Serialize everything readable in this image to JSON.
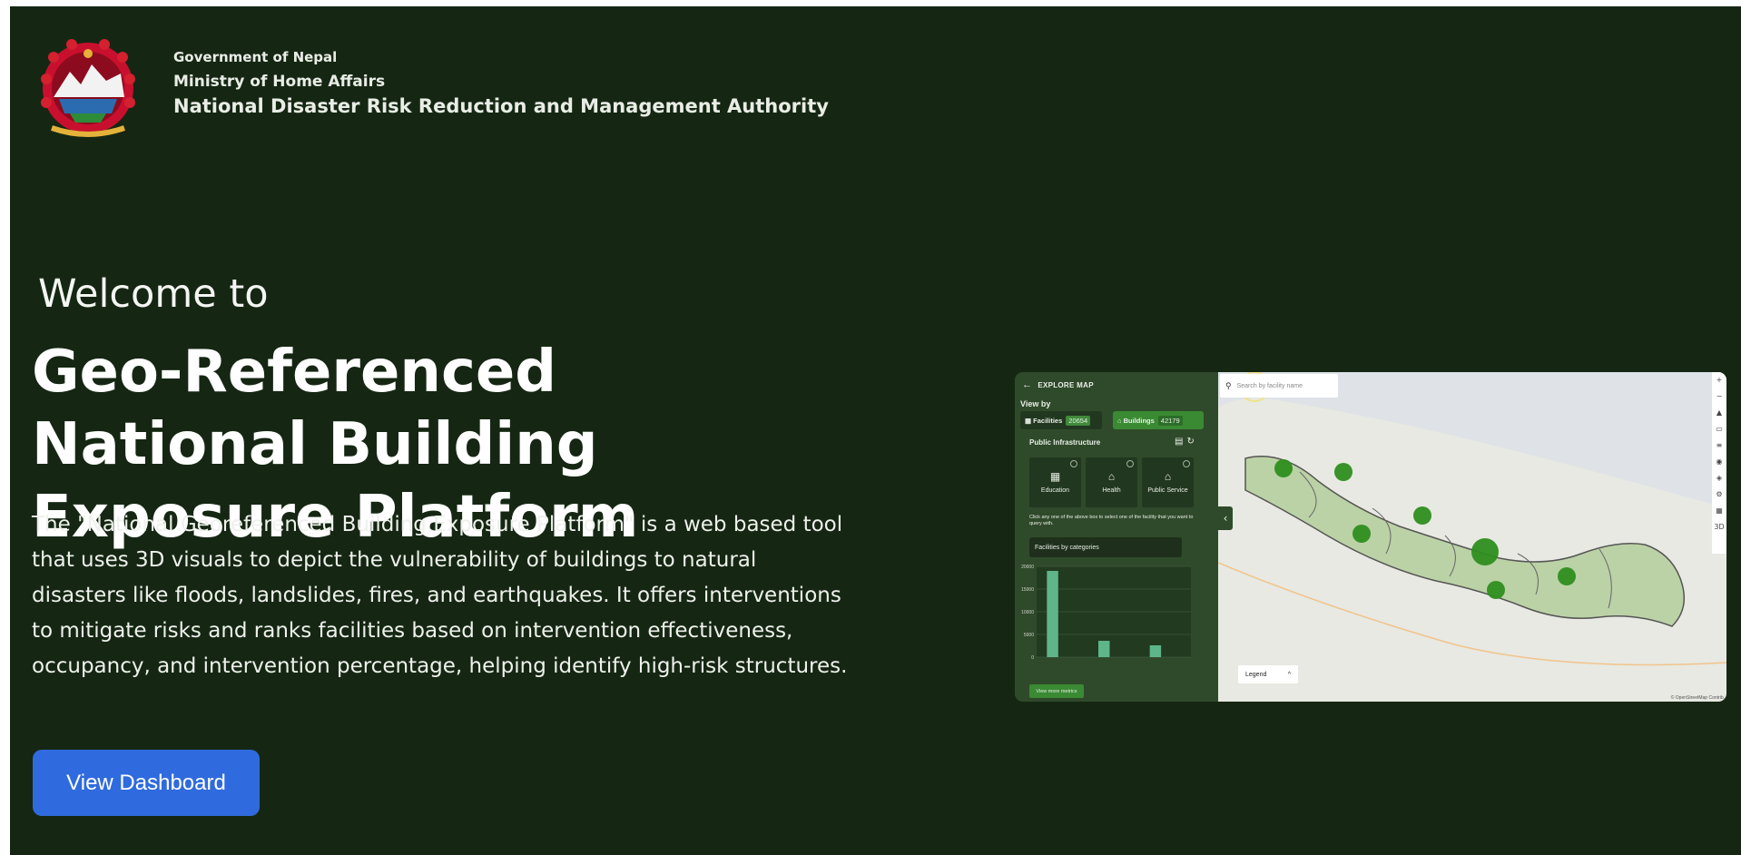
{
  "header": {
    "line1": "Government of Nepal",
    "line2": "Ministry of Home Affairs",
    "line3": "National Disaster Risk Reduction and Management Authority"
  },
  "hero": {
    "welcome": "Welcome to",
    "title": "Geo-Referenced National Building Exposure Platform",
    "description": "The \"National Georeferenced Building Exposure Platform\" is a web based tool that uses 3D visuals to depict the vulnerability of buildings to natural disasters like floods, landslides, fires, and earthquakes. It offers interventions to mitigate risks and ranks facilities based on intervention effectiveness, occupancy, and intervention percentage, helping identify high-risk structures.",
    "cta_label": "View Dashboard"
  },
  "colors": {
    "background": "#152713",
    "cta": "#2f6bde",
    "panel": "#2f4a2a",
    "accent_green": "#3a8a33",
    "bar": "#5fb58a",
    "map_marker": "#2f8f1f"
  },
  "preview": {
    "panel_title": "EXPLORE MAP",
    "view_by_label": "View by",
    "facilities_label": "Facilities",
    "facilities_count": "20654",
    "buildings_label": "Buildings",
    "buildings_count": "42179",
    "public_infra_label": "Public Infrastructure",
    "categories": [
      {
        "label": "Education",
        "icon": "building-icon"
      },
      {
        "label": "Health",
        "icon": "house-icon"
      },
      {
        "label": "Public Service",
        "icon": "bank-icon"
      }
    ],
    "hint": "Click any one of the above box to select one of the facility that you want to query with.",
    "facilities_by_categories": "Facilities by categories",
    "chart_ticks": [
      "20000",
      "15000",
      "10000",
      "5000",
      "0"
    ],
    "bar_values": [
      19000,
      3600,
      2600
    ],
    "view_more_label": "View more metrics",
    "search_placeholder": "Search by facility name",
    "legend_label": "Legend",
    "attribution": "© OpenStreetMap Contrib."
  }
}
